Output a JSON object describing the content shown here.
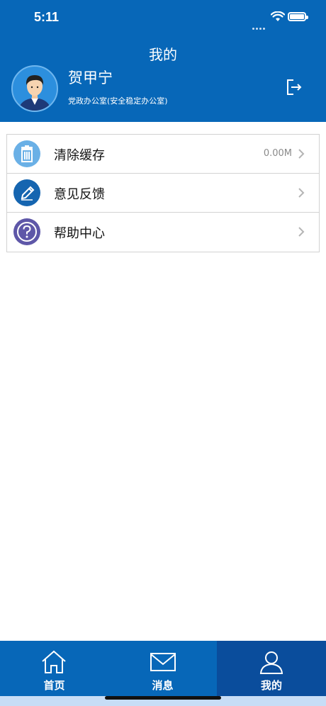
{
  "status_bar": {
    "time": "5:11"
  },
  "header": {
    "title": "我的",
    "user": {
      "name": "贺甲宁",
      "department": "党政办公室(安全稳定办公室)"
    }
  },
  "menu": {
    "items": [
      {
        "label": "清除缓存",
        "value": "0.00M",
        "icon": "trash-icon"
      },
      {
        "label": "意见反馈",
        "value": "",
        "icon": "pencil-icon"
      },
      {
        "label": "帮助中心",
        "value": "",
        "icon": "question-icon"
      }
    ]
  },
  "tabbar": {
    "tabs": [
      {
        "label": "首页",
        "icon": "home-icon",
        "active": false
      },
      {
        "label": "消息",
        "icon": "mail-icon",
        "active": false
      },
      {
        "label": "我的",
        "icon": "user-icon",
        "active": true
      }
    ]
  },
  "colors": {
    "primary": "#0767b8",
    "tab_active": "#0a4d9c",
    "trash_icon_bg": "#6ab0e6",
    "pencil_icon_bg": "#1565b0",
    "question_icon_bg": "#5e57a8"
  }
}
